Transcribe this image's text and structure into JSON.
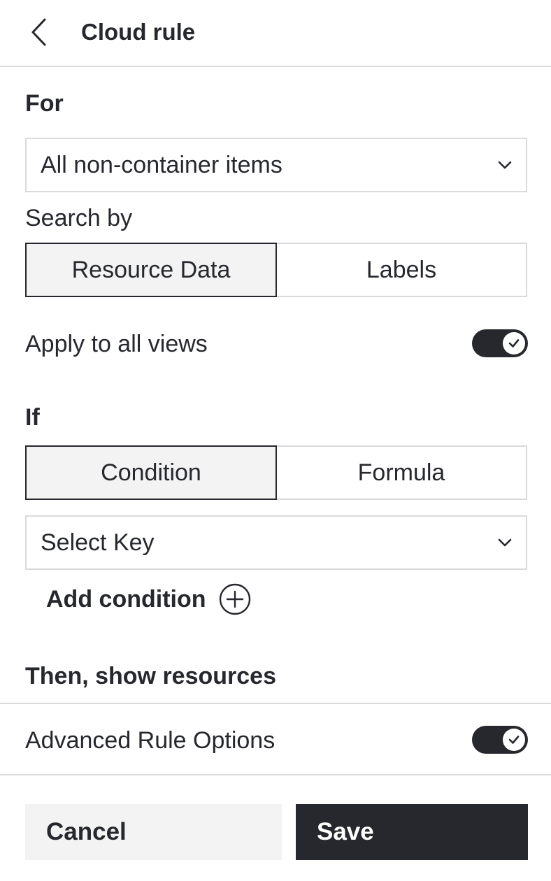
{
  "header": {
    "title": "Cloud rule",
    "back_icon": "chevron-left-icon"
  },
  "for_section": {
    "title": "For",
    "select_value": "All non-container items",
    "select_icon": "chevron-down-icon"
  },
  "search_by": {
    "label": "Search by",
    "options": [
      "Resource Data",
      "Labels"
    ],
    "selected": "Resource Data"
  },
  "apply_all_views": {
    "label": "Apply to all views",
    "enabled": true,
    "icon": "check-icon"
  },
  "if_section": {
    "title": "If",
    "modes": [
      "Condition",
      "Formula"
    ],
    "selected": "Condition",
    "key_select_value": "Select Key",
    "add_condition_label": "Add condition",
    "add_icon": "plus-circle-icon"
  },
  "then_section": {
    "title": "Then, show resources"
  },
  "advanced": {
    "label": "Advanced Rule Options",
    "enabled": true,
    "icon": "check-icon"
  },
  "footer": {
    "cancel_label": "Cancel",
    "save_label": "Save"
  },
  "colors": {
    "primary_dark": "#26282d",
    "border": "#d9dadc",
    "active_bg": "#f3f3f3",
    "background": "#ffffff"
  }
}
